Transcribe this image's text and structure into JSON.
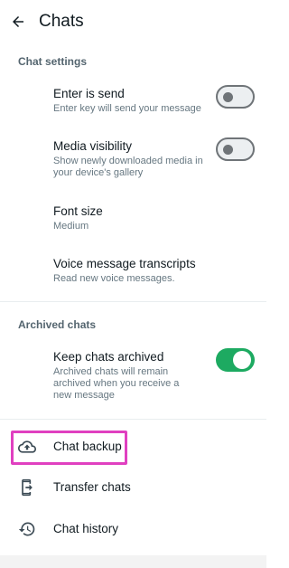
{
  "appbar": {
    "title": "Chats",
    "back_icon": "arrow-back-icon"
  },
  "chat_settings": {
    "header": "Chat settings",
    "items": [
      {
        "title": "Enter is send",
        "subtitle": "Enter key will send your message",
        "toggle": false
      },
      {
        "title": "Media visibility",
        "subtitle": "Show newly downloaded media in your device's gallery",
        "toggle": false
      },
      {
        "title": "Font size",
        "subtitle": "Medium"
      },
      {
        "title": "Voice message transcripts",
        "subtitle": "Read new voice messages."
      }
    ]
  },
  "archived_chats": {
    "header": "Archived chats",
    "items": [
      {
        "title": "Keep chats archived",
        "subtitle": "Archived chats will remain archived when you receive a new message",
        "toggle": true
      }
    ]
  },
  "actions": [
    {
      "label": "Chat backup",
      "icon": "cloud-upload-icon"
    },
    {
      "label": "Transfer chats",
      "icon": "phone-transfer-icon"
    },
    {
      "label": "Chat history",
      "icon": "history-icon"
    }
  ],
  "colors": {
    "accent": "#1daa61",
    "highlight": "#e040c0",
    "subtext": "#667781"
  }
}
